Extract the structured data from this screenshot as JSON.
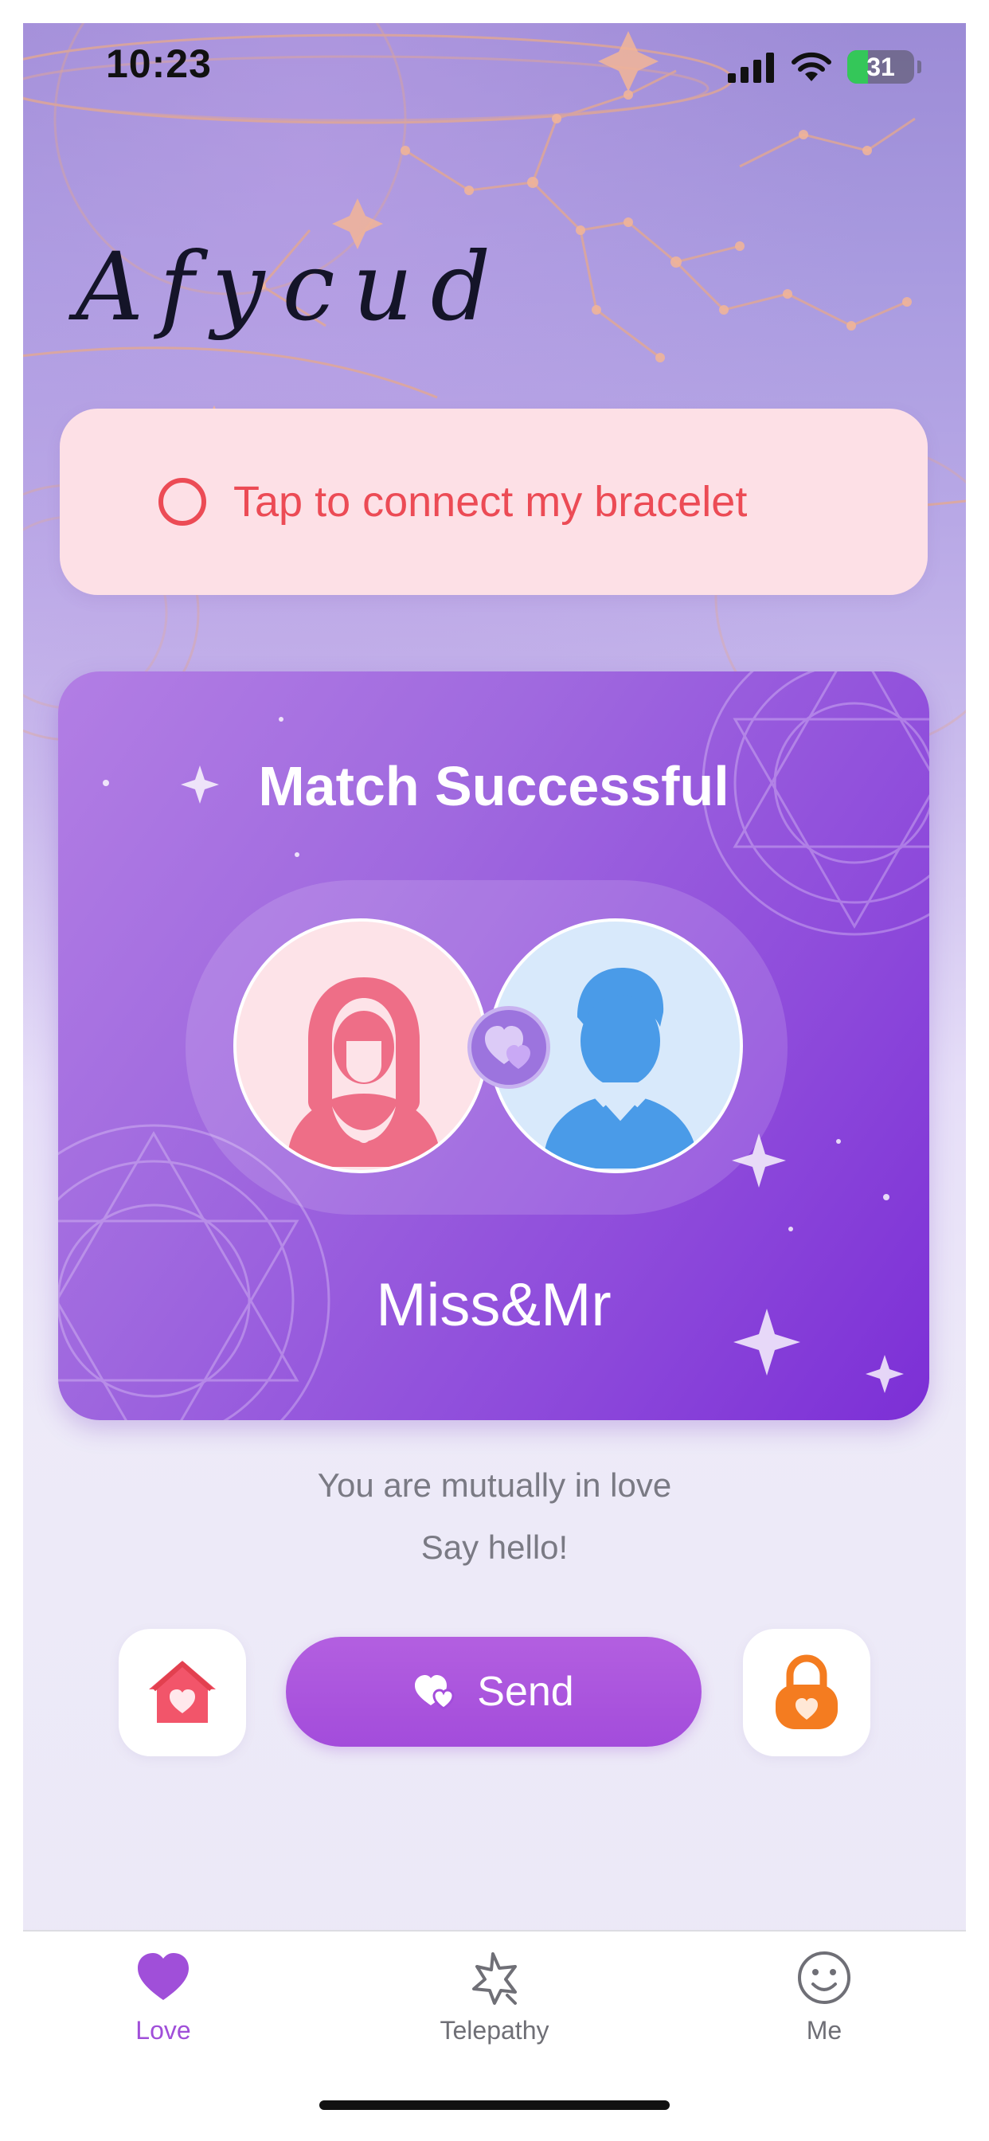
{
  "status_bar": {
    "time": "10:23",
    "battery_level": "31",
    "icons": [
      "signal-icon",
      "wifi-icon",
      "battery-charging-icon"
    ]
  },
  "brand": {
    "logo_text": "Afycud"
  },
  "connect": {
    "label": "Tap to connect my bracelet",
    "icon": "ring-icon",
    "color": "#ec4b55"
  },
  "match": {
    "title": "Match Successful",
    "pair_name": "Miss&Mr",
    "female_avatar": "female-avatar-icon",
    "male_avatar": "male-avatar-icon",
    "badge": "hearts-icon"
  },
  "messages": {
    "line1": "You are mutually in love",
    "line2": "Say hello!"
  },
  "actions": {
    "send_label": "Send",
    "left_icon": "home-heart-icon",
    "right_icon": "lock-heart-icon",
    "accent": "#a34cdb"
  },
  "tabs": [
    {
      "label": "Love",
      "icon": "heart-icon",
      "active": true
    },
    {
      "label": "Telepathy",
      "icon": "star-icon",
      "active": false
    },
    {
      "label": "Me",
      "icon": "smiley-icon",
      "active": false
    }
  ]
}
